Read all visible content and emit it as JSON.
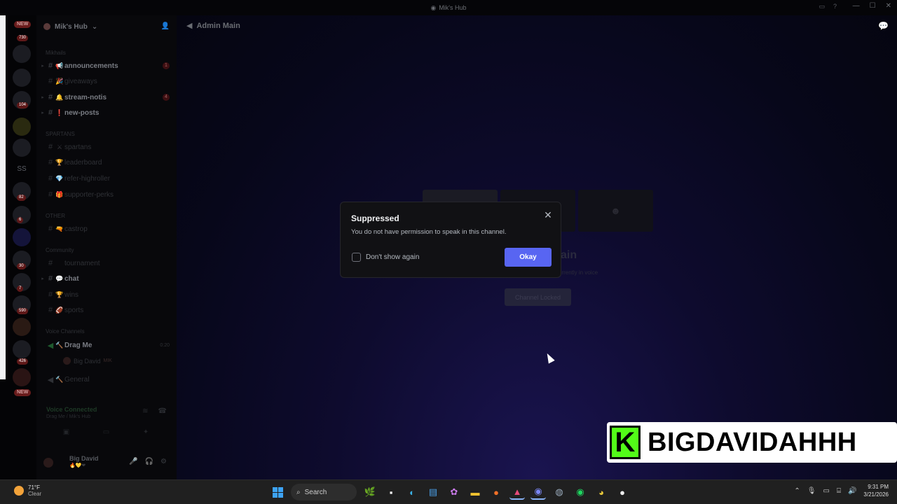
{
  "window": {
    "title": "Mik's Hub"
  },
  "rail": {
    "badges": [
      "730",
      "104",
      "82",
      "6",
      "30",
      "7",
      "590",
      "426"
    ],
    "new_label": "NEW",
    "ss_label": "SS"
  },
  "sidebar": {
    "server_name": "Mik's Hub",
    "categories": {
      "mikhails": "Mikhails",
      "spartans": "SPARTANS",
      "other": "OTHER",
      "community": "Community",
      "voice": "Voice Channels"
    },
    "channels": [
      {
        "name": "announcements",
        "count": "1"
      },
      {
        "name": "giveaways"
      },
      {
        "name": "stream-notis",
        "count": "4"
      },
      {
        "name": "new-posts"
      },
      {
        "name": "spartans"
      },
      {
        "name": "leaderboard"
      },
      {
        "name": "refer-highroller"
      },
      {
        "name": "supporter-perks"
      },
      {
        "name": "castrop"
      },
      {
        "name": "tournament"
      },
      {
        "name": "chat"
      },
      {
        "name": "wins"
      },
      {
        "name": "sports"
      }
    ],
    "voice_channels": [
      {
        "name": "Drag Me",
        "timer": "0:20"
      },
      {
        "name": "General"
      }
    ],
    "voice_user": {
      "name": "Big David",
      "tag": "MIK"
    },
    "voice_panel": {
      "status": "Voice Connected",
      "location": "Drag Me / Mik's Hub"
    },
    "user": {
      "name": "Big David"
    }
  },
  "main": {
    "channel_title": "Admin Main",
    "bg_title": "ain",
    "bg_sub": "urrently in voice",
    "bg_locked": "Channel Locked"
  },
  "modal": {
    "title": "Suppressed",
    "description": "You do not have permission to speak in this channel.",
    "checkbox_label": "Don't show again",
    "okay_label": "Okay"
  },
  "overlay": {
    "handle": "BIGDAVIDAHHH",
    "logo_letter": "K"
  },
  "taskbar": {
    "weather_temp": "71°F",
    "weather_cond": "Clear",
    "search_placeholder": "Search",
    "time": "9:31 PM",
    "date": "3/21/2026"
  },
  "colors": {
    "accent": "#5865f2",
    "kick_green": "#53fc18"
  }
}
